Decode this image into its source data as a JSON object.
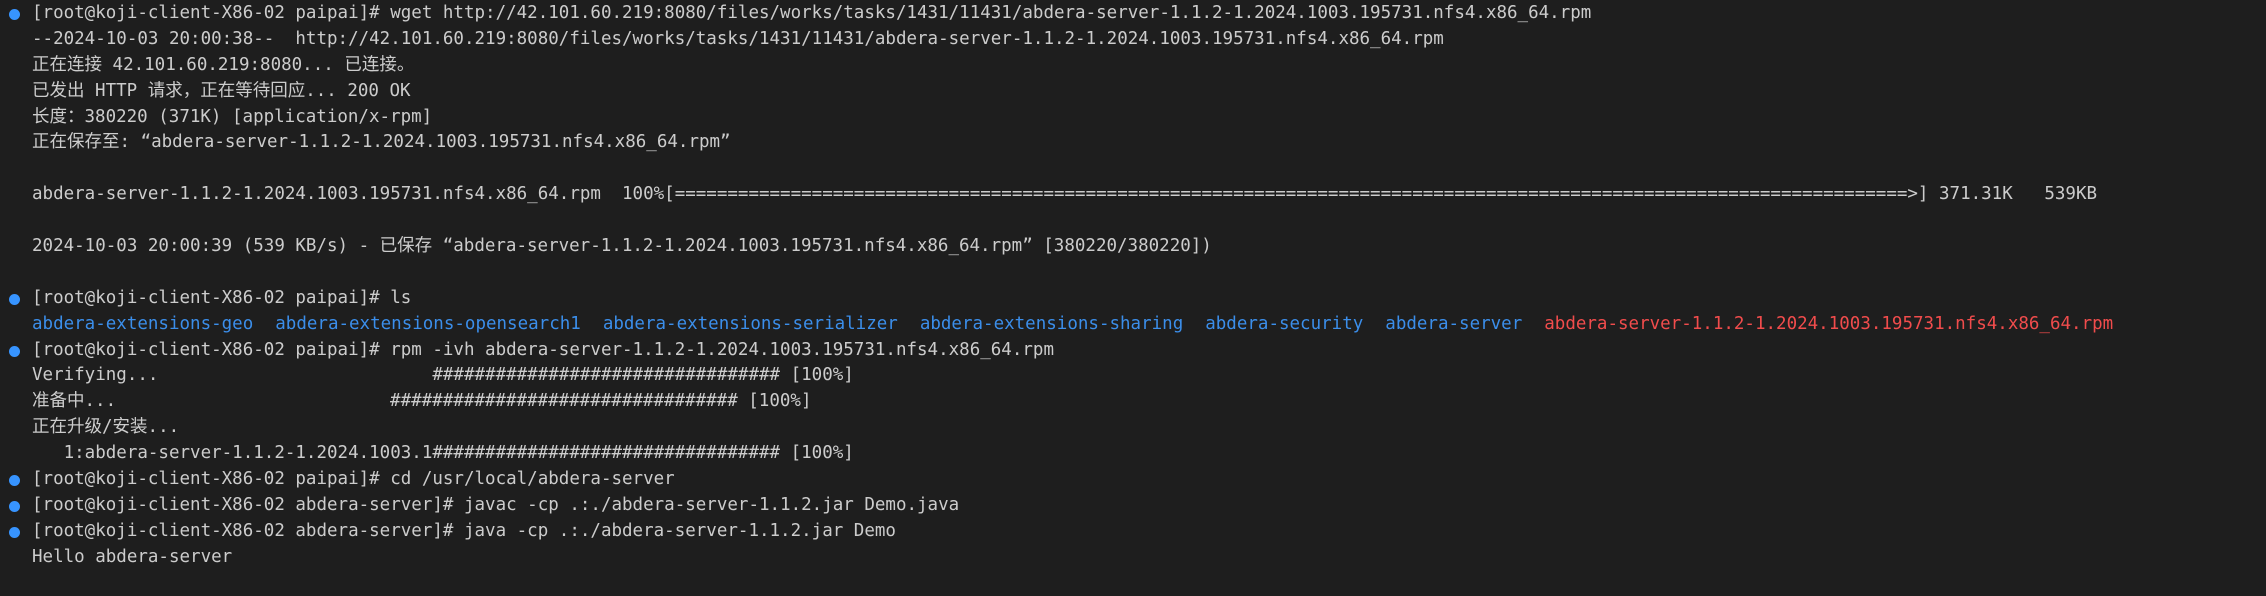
{
  "terminal": {
    "lines": [
      {
        "dot": true,
        "text": "[root@koji-client-X86-02 paipai]# wget http://42.101.60.219:8080/files/works/tasks/1431/11431/abdera-server-1.1.2-1.2024.1003.195731.nfs4.x86_64.rpm"
      },
      {
        "dot": false,
        "text": "--2024-10-03 20:00:38--  http://42.101.60.219:8080/files/works/tasks/1431/11431/abdera-server-1.1.2-1.2024.1003.195731.nfs4.x86_64.rpm"
      },
      {
        "dot": false,
        "text": "正在连接 42.101.60.219:8080... 已连接。"
      },
      {
        "dot": false,
        "text": "已发出 HTTP 请求，正在等待回应... 200 OK"
      },
      {
        "dot": false,
        "text": "长度：380220 (371K) [application/x-rpm]"
      },
      {
        "dot": false,
        "text": "正在保存至: “abdera-server-1.1.2-1.2024.1003.195731.nfs4.x86_64.rpm”"
      },
      {
        "dot": false,
        "text": ""
      },
      {
        "dot": false,
        "text": "abdera-server-1.1.2-1.2024.1003.195731.nfs4.x86_64.rpm  100%[=====================================================================================================================>] 371.31K   539KB"
      },
      {
        "dot": false,
        "text": ""
      },
      {
        "dot": false,
        "text": "2024-10-03 20:00:39 (539 KB/s) - 已保存 “abdera-server-1.1.2-1.2024.1003.195731.nfs4.x86_64.rpm” [380220/380220])"
      },
      {
        "dot": false,
        "text": ""
      },
      {
        "dot": true,
        "text": "[root@koji-client-X86-02 paipai]# ls"
      }
    ],
    "ls_output": [
      {
        "name": "abdera-extensions-geo",
        "kind": "dir"
      },
      {
        "name": "abdera-extensions-opensearch1",
        "kind": "dir"
      },
      {
        "name": "abdera-extensions-serializer",
        "kind": "dir"
      },
      {
        "name": "abdera-extensions-sharing",
        "kind": "dir"
      },
      {
        "name": "abdera-security",
        "kind": "dir"
      },
      {
        "name": "abdera-server",
        "kind": "dir"
      },
      {
        "name": "abdera-server-1.1.2-1.2024.1003.195731.nfs4.x86_64.rpm",
        "kind": "rpm"
      }
    ],
    "lines_after": [
      {
        "dot": true,
        "text": "[root@koji-client-X86-02 paipai]# rpm -ivh abdera-server-1.1.2-1.2024.1003.195731.nfs4.x86_64.rpm"
      },
      {
        "dot": false,
        "text": "Verifying...                          ################################# [100%]"
      },
      {
        "dot": false,
        "text": "准备中...                          ################################# [100%]"
      },
      {
        "dot": false,
        "text": "正在升级/安装..."
      },
      {
        "dot": false,
        "text": "   1:abdera-server-1.1.2-1.2024.1003.1################################# [100%]"
      },
      {
        "dot": true,
        "text": "[root@koji-client-X86-02 paipai]# cd /usr/local/abdera-server"
      },
      {
        "dot": true,
        "text": "[root@koji-client-X86-02 abdera-server]# javac -cp .:./abdera-server-1.1.2.jar Demo.java"
      },
      {
        "dot": true,
        "text": "[root@koji-client-X86-02 abdera-server]# java -cp .:./abdera-server-1.1.2.jar Demo"
      },
      {
        "dot": false,
        "text": "Hello abdera-server"
      }
    ],
    "colors": {
      "background": "#1e1e1e",
      "text": "#cccccc",
      "prompt_dot": "#3794ff",
      "dir": "#3b8eea",
      "rpm_file": "#f14c4c"
    }
  }
}
